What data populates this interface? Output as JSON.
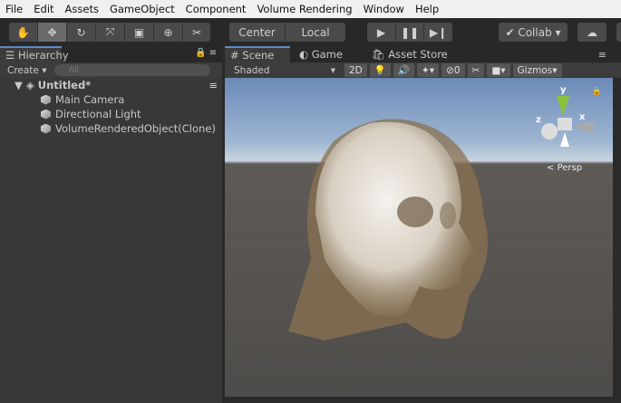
{
  "menu": [
    "File",
    "Edit",
    "Assets",
    "GameObject",
    "Component",
    "Volume Rendering",
    "Window",
    "Help"
  ],
  "toolbar": {
    "tools": [
      "hand-icon",
      "move-icon",
      "rotate-icon",
      "scale-icon",
      "rect-icon",
      "transform-icon",
      "custom-tool-icon"
    ],
    "pivot": "Center",
    "space": "Local",
    "collab": "Collab"
  },
  "hierarchy": {
    "title": "Hierarchy",
    "create": "Create",
    "search_placeholder": "All",
    "scene_name": "Untitled*",
    "items": [
      "Main Camera",
      "Directional Light",
      "VolumeRenderedObject(Clone)"
    ]
  },
  "scene_tabs": [
    "Scene",
    "Game",
    "Asset Store"
  ],
  "scene_toolbar": {
    "shading": "Shaded",
    "mode2d": "2D",
    "hidden_count": "0",
    "gizmos": "Gizmos"
  },
  "gizmo": {
    "y": "y",
    "x": "x",
    "z": "z",
    "projection": "Persp"
  }
}
